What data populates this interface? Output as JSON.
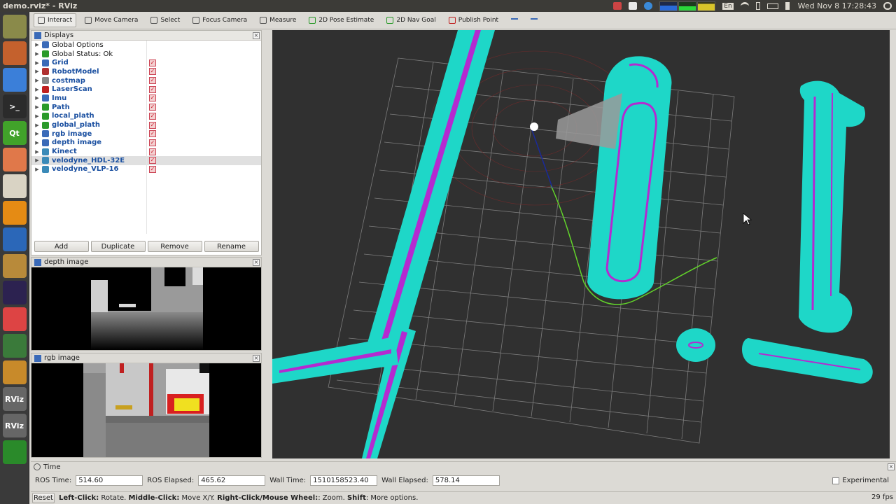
{
  "window": {
    "title": "demo.rviz* - RViz"
  },
  "systray": {
    "keyboard": "En",
    "clock": "Wed Nov  8 17:28:43"
  },
  "launcher": {
    "items": [
      {
        "name": "ubuntu-icon",
        "label": "",
        "color": "#8a8a4a"
      },
      {
        "name": "files-icon",
        "label": "",
        "color": "#c4612d"
      },
      {
        "name": "chrome-icon",
        "label": "",
        "color": "#3b7fd9"
      },
      {
        "name": "terminal-icon",
        "label": ">_",
        "color": "#2b2b2b"
      },
      {
        "name": "qt-icon",
        "label": "Qt",
        "color": "#41a22a"
      },
      {
        "name": "app-icon",
        "label": "",
        "color": "#e0784a"
      },
      {
        "name": "books-icon",
        "label": "",
        "color": "#d9d3c4"
      },
      {
        "name": "vlc-icon",
        "label": "",
        "color": "#e58b14"
      },
      {
        "name": "writer-icon",
        "label": "",
        "color": "#2b67b8"
      },
      {
        "name": "install-icon",
        "label": "",
        "color": "#b88a3a"
      },
      {
        "name": "eclipse-icon",
        "label": "",
        "color": "#2c2250"
      },
      {
        "name": "notes-icon",
        "label": "",
        "color": "#d44"
      },
      {
        "name": "python-icon",
        "label": "",
        "color": "#3a7a3a"
      },
      {
        "name": "archive-icon",
        "label": "",
        "color": "#c88a2a"
      },
      {
        "name": "rviz-icon",
        "label": "RViz",
        "color": "#666"
      },
      {
        "name": "rviz2-icon",
        "label": "RViz",
        "color": "#666"
      },
      {
        "name": "green-icon",
        "label": "",
        "color": "#2a8a2a"
      }
    ]
  },
  "toolbar": {
    "tools": [
      {
        "name": "interact",
        "label": "Interact",
        "active": true,
        "color": "#555"
      },
      {
        "name": "move-camera",
        "label": "Move Camera",
        "active": false,
        "color": "#555"
      },
      {
        "name": "select",
        "label": "Select",
        "active": false,
        "color": "#555"
      },
      {
        "name": "focus-camera",
        "label": "Focus Camera",
        "active": false,
        "color": "#555"
      },
      {
        "name": "measure",
        "label": "Measure",
        "active": false,
        "color": "#555"
      },
      {
        "name": "2d-pose-estimate",
        "label": "2D Pose Estimate",
        "active": false,
        "color": "#2a9a2a"
      },
      {
        "name": "2d-nav-goal",
        "label": "2D Nav Goal",
        "active": false,
        "color": "#2a9a2a"
      },
      {
        "name": "publish-point",
        "label": "Publish Point",
        "active": false,
        "color": "#c02020"
      }
    ]
  },
  "displays": {
    "title": "Displays",
    "items": [
      {
        "label": "Global Options",
        "plain": true,
        "checked": false,
        "icon_color": "#3a6ab8"
      },
      {
        "label": "Global Status: Ok",
        "plain": true,
        "checked": false,
        "icon_color": "#2a9a2a",
        "status": true
      },
      {
        "label": "Grid",
        "checked": true,
        "icon_color": "#3a6ab8"
      },
      {
        "label": "RobotModel",
        "checked": true,
        "icon_color": "#b03030"
      },
      {
        "label": "costmap",
        "checked": true,
        "icon_color": "#888"
      },
      {
        "label": "LaserScan",
        "checked": true,
        "icon_color": "#c02020"
      },
      {
        "label": "Imu",
        "checked": true,
        "icon_color": "#3a6ab8"
      },
      {
        "label": "Path",
        "checked": true,
        "icon_color": "#2a9a2a"
      },
      {
        "label": "local_plath",
        "checked": true,
        "icon_color": "#2a9a2a"
      },
      {
        "label": "global_plath",
        "checked": true,
        "icon_color": "#2a9a2a"
      },
      {
        "label": "rgb image",
        "checked": true,
        "icon_color": "#3a6ab8"
      },
      {
        "label": "depth image",
        "checked": true,
        "icon_color": "#3a6ab8"
      },
      {
        "label": "Kinect",
        "checked": true,
        "icon_color": "#3a8ab8"
      },
      {
        "label": "velodyne_HDL-32E",
        "checked": true,
        "icon_color": "#3a8ab8",
        "selected": true
      },
      {
        "label": "velodyne_VLP-16",
        "checked": true,
        "icon_color": "#3a8ab8"
      }
    ],
    "buttons": [
      "Add",
      "Duplicate",
      "Remove",
      "Rename"
    ]
  },
  "depth_panel": {
    "title": "depth image"
  },
  "rgb_panel": {
    "title": "rgb image"
  },
  "time_panel": {
    "title": "Time",
    "ros_time_label": "ROS Time:",
    "ros_time": "514.60",
    "ros_elapsed_label": "ROS Elapsed:",
    "ros_elapsed": "465.62",
    "wall_time_label": "Wall Time:",
    "wall_time": "1510158523.40",
    "wall_elapsed_label": "Wall Elapsed:",
    "wall_elapsed": "578.14",
    "experimental_label": "Experimental"
  },
  "status": {
    "reset_label": "Reset",
    "left_click_label": "Left-Click:",
    "left_click_text": " Rotate. ",
    "middle_click_label": "Middle-Click:",
    "middle_click_text": " Move X/Y. ",
    "right_click_label": "Right-Click/Mouse Wheel:",
    "right_click_text": ": Zoom. ",
    "shift_label": "Shift",
    "shift_text": ": More options.",
    "fps": "29 fps"
  },
  "colors": {
    "costmap_cyan": "#1ed7c8",
    "obstacle_magenta": "#b42ad0",
    "path_green": "#62d42a",
    "grid": "#8a8a8a",
    "bg": "#303030"
  }
}
